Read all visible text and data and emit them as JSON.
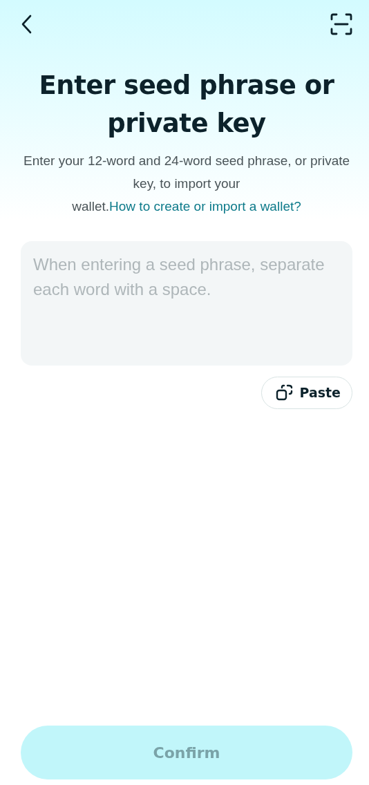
{
  "title": "Enter seed phrase or private key",
  "description": {
    "text": "Enter your 12-word and 24-word seed phrase, or private key, to import your wallet.",
    "link": "How to create or import a wallet?"
  },
  "input": {
    "placeholder": "When entering a seed phrase, separate each word with a space."
  },
  "paste_button": {
    "label": "Paste"
  },
  "confirm_button": {
    "label": "Confirm",
    "disabled": true
  }
}
